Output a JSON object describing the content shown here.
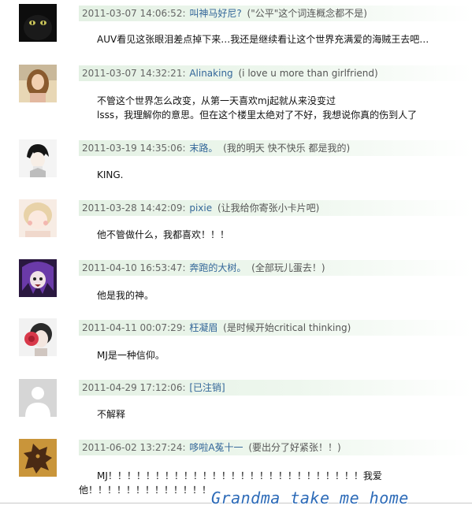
{
  "comments": [
    {
      "avatar_icon": "black-cat-avatar",
      "time": "2011-03-07 14:06:52:",
      "user": "叫神马好尼?",
      "signature": "(\"公平\"这个词连概念都不是)",
      "lines": [
        "AUV看见这张眼泪差点掉下来…我还是继续看让这个世界充满爱的海贼王去吧…"
      ]
    },
    {
      "avatar_icon": "girl-portrait-avatar",
      "time": "2011-03-07 14:32:21:",
      "user": "Alinaking",
      "signature": "(i love u more than girlfriend)",
      "lines": [
        "不管这个世界怎么改变，从第一天喜欢mj起就从来没变过",
        "lsss，我理解你的意思。但在这个楼里太绝对了不好，我想说你真的伤到人了"
      ]
    },
    {
      "avatar_icon": "anime-boy-avatar",
      "time": "2011-03-19 14:35:06:",
      "user": "末路。",
      "signature": "(我的明天 快不快乐 都是我的)",
      "lines": [
        "KING."
      ]
    },
    {
      "avatar_icon": "pastel-girl-avatar",
      "time": "2011-03-28 14:42:09:",
      "user": "pixie",
      "signature": "(让我给你寄张小卡片吧)",
      "lines": [
        "他不管做什么，我都喜欢！！！"
      ]
    },
    {
      "avatar_icon": "purple-anime-avatar",
      "time": "2011-04-10 16:53:47:",
      "user": "奔跑的大树。",
      "signature": "(全部玩儿蛋去！)",
      "lines": [
        "他是我的神。"
      ]
    },
    {
      "avatar_icon": "flower-hair-avatar",
      "time": "2011-04-11 00:07:29:",
      "user": "枉凝眉",
      "signature": "(是时候开始critical thinking)",
      "lines": [
        "MJ是一种信仰。"
      ]
    },
    {
      "avatar_icon": "default-user-avatar",
      "time": "2011-04-29 17:12:06:",
      "user": "[已注销]",
      "signature": "",
      "lines": [
        "不解释"
      ]
    },
    {
      "avatar_icon": "dragon-avatar",
      "time": "2011-06-02 13:27:24:",
      "user": "哆啦A菟十一",
      "signature": "(要出分了好紧张！！)",
      "lines": [
        "MJ！！！！！！！！！！！！！！！！！！！！！！！！！！！我爱",
        "他！！！！！！！！！！！！！"
      ]
    }
  ],
  "watermark": "Grandma take me home"
}
